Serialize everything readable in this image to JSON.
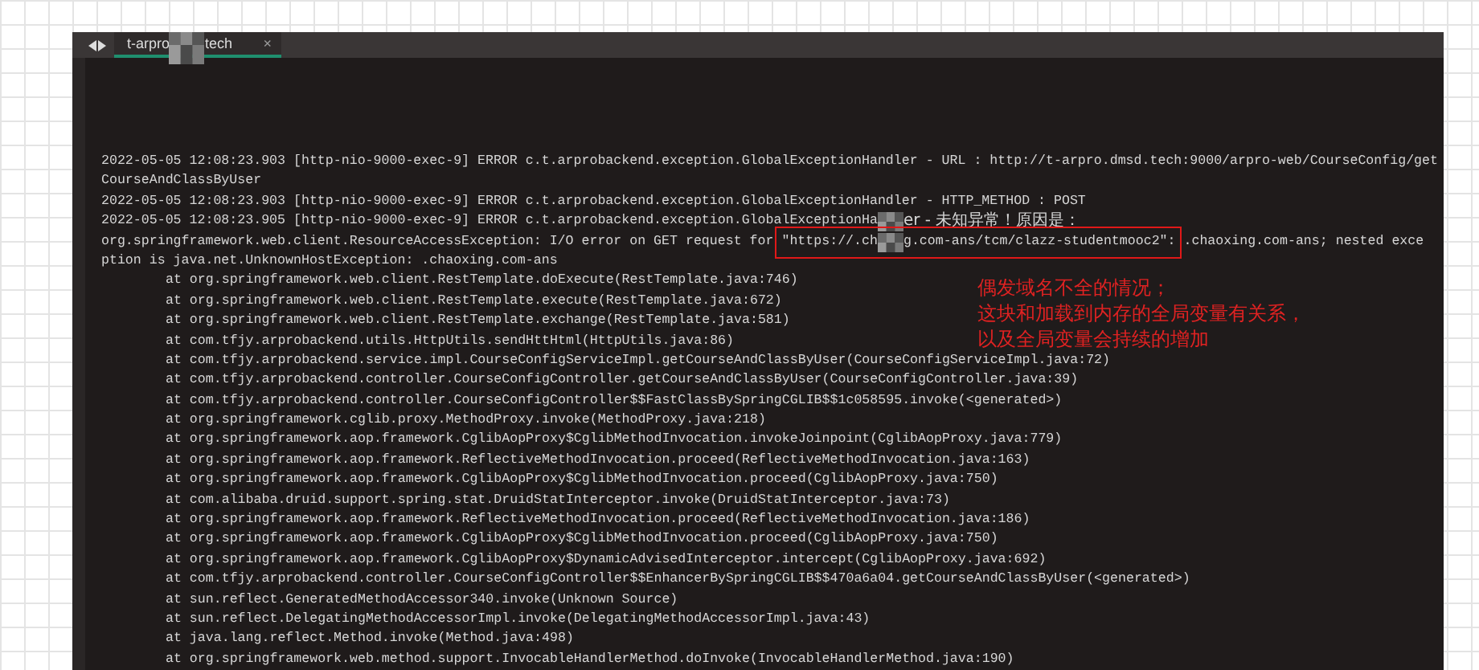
{
  "tab": {
    "label_parts": [
      "t-arpro",
      "tech"
    ],
    "close": "×",
    "selected": true
  },
  "lines": [
    {
      "kind": "log",
      "segments": [
        {
          "kind": "text",
          "text": "2022-05-05 12:08:23.903 [http-nio-9000-exec-9] ERROR c.t.arprobackend.exception.GlobalExceptionHandler - URL : http://t-arpro.dmsd.tech:9000/arpro-web/CourseConfig/get"
        }
      ]
    },
    {
      "kind": "log",
      "segments": [
        {
          "kind": "text",
          "text": "CourseAndClassByUser"
        }
      ]
    },
    {
      "kind": "log",
      "segments": [
        {
          "kind": "text",
          "text": "2022-05-05 12:08:23.903 [http-nio-9000-exec-9] ERROR c.t.arprobackend.exception.GlobalExceptionHandler - HTTP_METHOD : POST"
        }
      ]
    },
    {
      "kind": "log",
      "segments": [
        {
          "kind": "text",
          "text": "2022-05-05 12:08:23.905 [http-nio-9000-exec-9] ERROR c.t.arprobackend.exception.GlobalExceptionHa"
        },
        {
          "kind": "mosaic"
        },
        {
          "kind": "text",
          "text": "er - 未知异常！原因是："
        }
      ]
    },
    {
      "kind": "log",
      "segments": [
        {
          "kind": "text",
          "text": "org.springframework.web.client.ResourceAccessException: I/O error on GET request for "
        },
        {
          "kind": "box",
          "segments": [
            {
              "kind": "text",
              "text": "\"https://.ch"
            },
            {
              "kind": "mosaic"
            },
            {
              "kind": "text",
              "text": "g.com-ans/tcm/clazz-studentmooc2\":"
            }
          ]
        },
        {
          "kind": "text",
          "text": " .chaoxing.com-ans; nested exce"
        }
      ]
    },
    {
      "kind": "log",
      "segments": [
        {
          "kind": "text",
          "text": "ption is java.net.UnknownHostException: .chaoxing.com-ans"
        }
      ]
    },
    {
      "kind": "frame",
      "segments": [
        {
          "kind": "text",
          "text": "at org.springframework.web.client.RestTemplate.doExecute(RestTemplate.java:746)"
        }
      ]
    },
    {
      "kind": "frame",
      "segments": [
        {
          "kind": "text",
          "text": "at org.springframework.web.client.RestTemplate.execute(RestTemplate.java:672)"
        }
      ]
    },
    {
      "kind": "frame",
      "segments": [
        {
          "kind": "text",
          "text": "at org.springframework.web.client.RestTemplate.exchange(RestTemplate.java:581)"
        }
      ]
    },
    {
      "kind": "frame",
      "segments": [
        {
          "kind": "text",
          "text": "at com.tfjy.arprobackend.utils.HttpUtils.sendHttHtml(HttpUtils.java:86)"
        }
      ]
    },
    {
      "kind": "frame",
      "segments": [
        {
          "kind": "text",
          "text": "at com.tfjy.arprobackend.service.impl.CourseConfigServiceImpl.getCourseAndClassByUser(CourseConfigServiceImpl.java:72)"
        }
      ]
    },
    {
      "kind": "frame",
      "segments": [
        {
          "kind": "text",
          "text": "at com.tfjy.arprobackend.controller.CourseConfigController.getCourseAndClassByUser(CourseConfigController.java:39)"
        }
      ]
    },
    {
      "kind": "frame",
      "segments": [
        {
          "kind": "text",
          "text": "at com.tfjy.arprobackend.controller.CourseConfigController$$FastClassBySpringCGLIB$$1c058595.invoke(<generated>)"
        }
      ]
    },
    {
      "kind": "frame",
      "segments": [
        {
          "kind": "text",
          "text": "at org.springframework.cglib.proxy.MethodProxy.invoke(MethodProxy.java:218)"
        }
      ]
    },
    {
      "kind": "frame",
      "segments": [
        {
          "kind": "text",
          "text": "at org.springframework.aop.framework.CglibAopProxy$CglibMethodInvocation.invokeJoinpoint(CglibAopProxy.java:779)"
        }
      ]
    },
    {
      "kind": "frame",
      "segments": [
        {
          "kind": "text",
          "text": "at org.springframework.aop.framework.ReflectiveMethodInvocation.proceed(ReflectiveMethodInvocation.java:163)"
        }
      ]
    },
    {
      "kind": "frame",
      "segments": [
        {
          "kind": "text",
          "text": "at org.springframework.aop.framework.CglibAopProxy$CglibMethodInvocation.proceed(CglibAopProxy.java:750)"
        }
      ]
    },
    {
      "kind": "frame",
      "segments": [
        {
          "kind": "text",
          "text": "at com.alibaba.druid.support.spring.stat.DruidStatInterceptor.invoke(DruidStatInterceptor.java:73)"
        }
      ]
    },
    {
      "kind": "frame",
      "segments": [
        {
          "kind": "text",
          "text": "at org.springframework.aop.framework.ReflectiveMethodInvocation.proceed(ReflectiveMethodInvocation.java:186)"
        }
      ]
    },
    {
      "kind": "frame",
      "segments": [
        {
          "kind": "text",
          "text": "at org.springframework.aop.framework.CglibAopProxy$CglibMethodInvocation.proceed(CglibAopProxy.java:750)"
        }
      ]
    },
    {
      "kind": "frame",
      "segments": [
        {
          "kind": "text",
          "text": "at org.springframework.aop.framework.CglibAopProxy$DynamicAdvisedInterceptor.intercept(CglibAopProxy.java:692)"
        }
      ]
    },
    {
      "kind": "frame",
      "segments": [
        {
          "kind": "text",
          "text": "at com.tfjy.arprobackend.controller.CourseConfigController$$EnhancerBySpringCGLIB$$470a6a04.getCourseAndClassByUser(<generated>)"
        }
      ]
    },
    {
      "kind": "frame",
      "segments": [
        {
          "kind": "text",
          "text": "at sun.reflect.GeneratedMethodAccessor340.invoke(Unknown Source)"
        }
      ]
    },
    {
      "kind": "frame",
      "segments": [
        {
          "kind": "text",
          "text": "at sun.reflect.DelegatingMethodAccessorImpl.invoke(DelegatingMethodAccessorImpl.java:43)"
        }
      ]
    },
    {
      "kind": "frame",
      "segments": [
        {
          "kind": "text",
          "text": "at java.lang.reflect.Method.invoke(Method.java:498)"
        }
      ]
    },
    {
      "kind": "frame",
      "segments": [
        {
          "kind": "text",
          "text": "at org.springframework.web.method.support.InvocableHandlerMethod.doInvoke(InvocableHandlerMethod.java:190)"
        }
      ]
    }
  ],
  "annotation": {
    "lines": [
      "偶发域名不全的情况；",
      "这块和加载到内存的全局变量有关系，",
      "以及全局变量会持续的增加"
    ]
  }
}
